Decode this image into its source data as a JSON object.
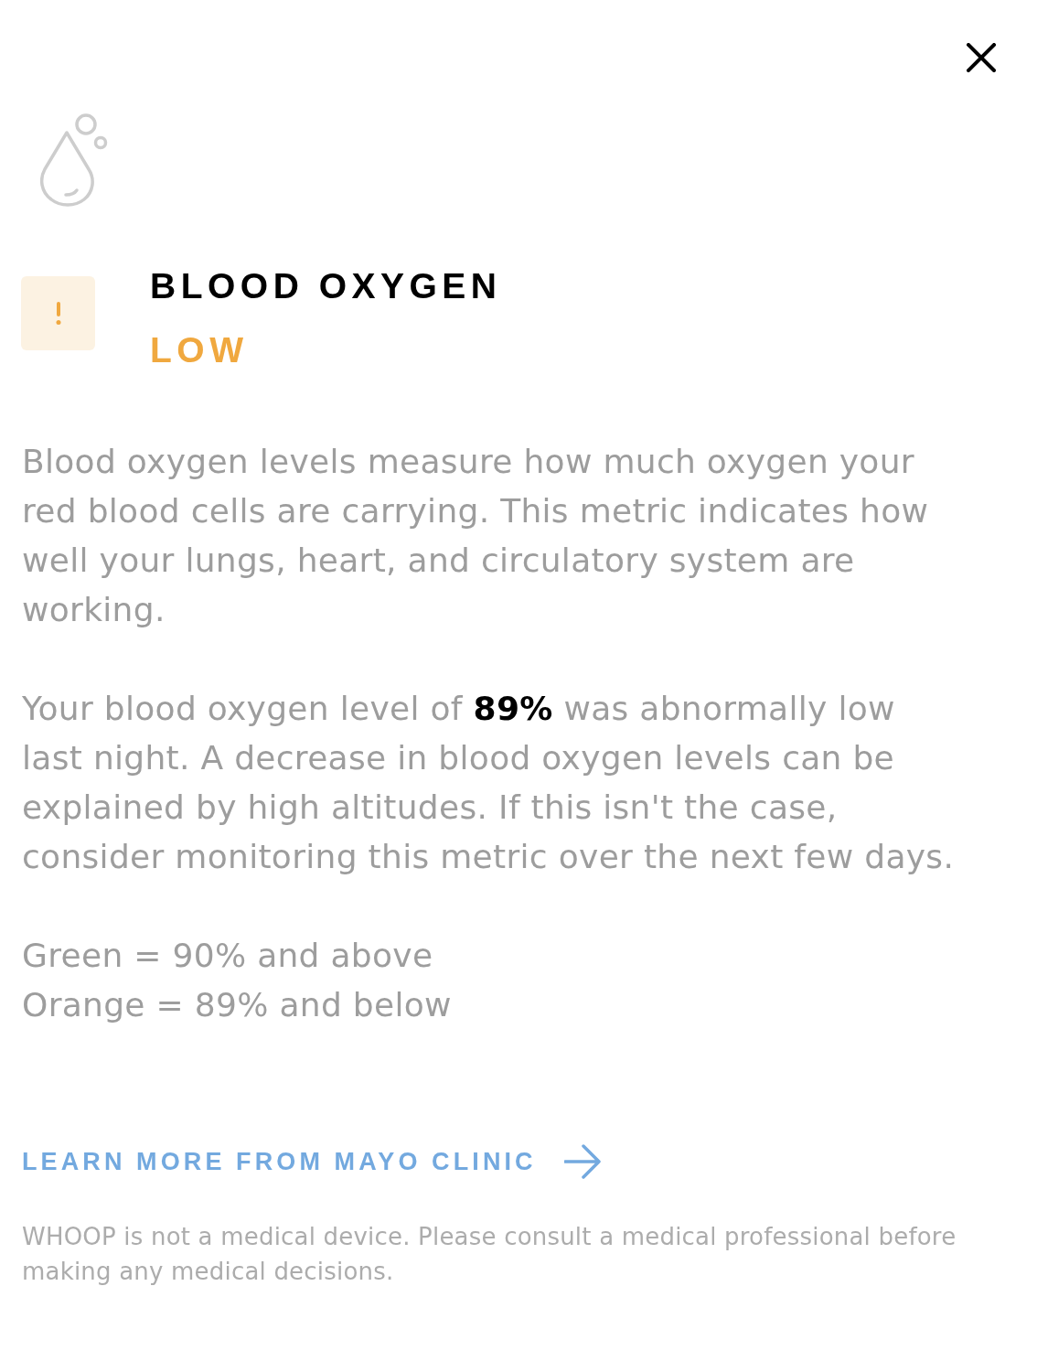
{
  "header": {
    "title": "BLOOD OXYGEN",
    "status": {
      "label": "LOW",
      "alert": true
    }
  },
  "paragraphs": [
    "Blood oxygen levels measure how much oxygen your red blood cells are carrying. This metric indicates how well your lungs, heart, and circulatory system are working.",
    "Your blood oxygen level of **89%** was abnormally low last night. A decrease in blood oxygen levels can be explained by high altitudes. If this isn't the case, consider monitoring this metric over the next few days."
  ],
  "legend": [
    "Green = 90% and above",
    "Orange = 89% and below"
  ],
  "link": {
    "label": "LEARN MORE FROM MAYO CLINIC"
  },
  "disclaimer": "WHOOP is not a medical device. Please consult a medical professional before making any medical decisions."
}
